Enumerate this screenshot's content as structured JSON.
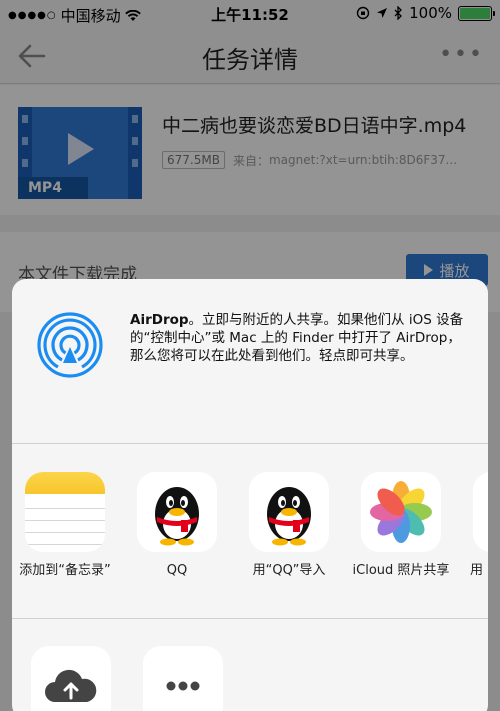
{
  "status_bar": {
    "signal": "●●●●○",
    "carrier": "中国移动",
    "time": "上午11:52",
    "battery_percent": "100%",
    "battery_level": 1.0
  },
  "nav": {
    "title": "任务详情",
    "more": "•••"
  },
  "task": {
    "thumb_label": "MP4",
    "filename": "中二病也要谈恋爱BD日语中字.mp4",
    "size": "677.5MB",
    "source_label": "来自：",
    "source_value": "magnet:?xt=urn:btih:8D6F37..."
  },
  "download": {
    "status": "本文件下载完成",
    "play_label": "播放"
  },
  "share": {
    "airdrop_title": "AirDrop",
    "airdrop_desc": "。立即与附近的人共享。如果他们从 iOS 设备的“控制中心”或 Mac 上的 Finder 中打开了 AirDrop，那么您将可以在此处看到他们。轻点即可共享。",
    "apps": [
      {
        "label": "添加到“备忘录”",
        "icon": "notes-icon"
      },
      {
        "label": "QQ",
        "icon": "qq-icon"
      },
      {
        "label": "用“QQ”导入",
        "icon": "qq-icon"
      },
      {
        "label": "iCloud 照片共享",
        "icon": "photos-icon"
      },
      {
        "label": "用",
        "icon": "app-icon"
      }
    ],
    "actions": [
      {
        "icon": "cloud-upload-icon"
      },
      {
        "icon": "more-icon"
      }
    ]
  }
}
